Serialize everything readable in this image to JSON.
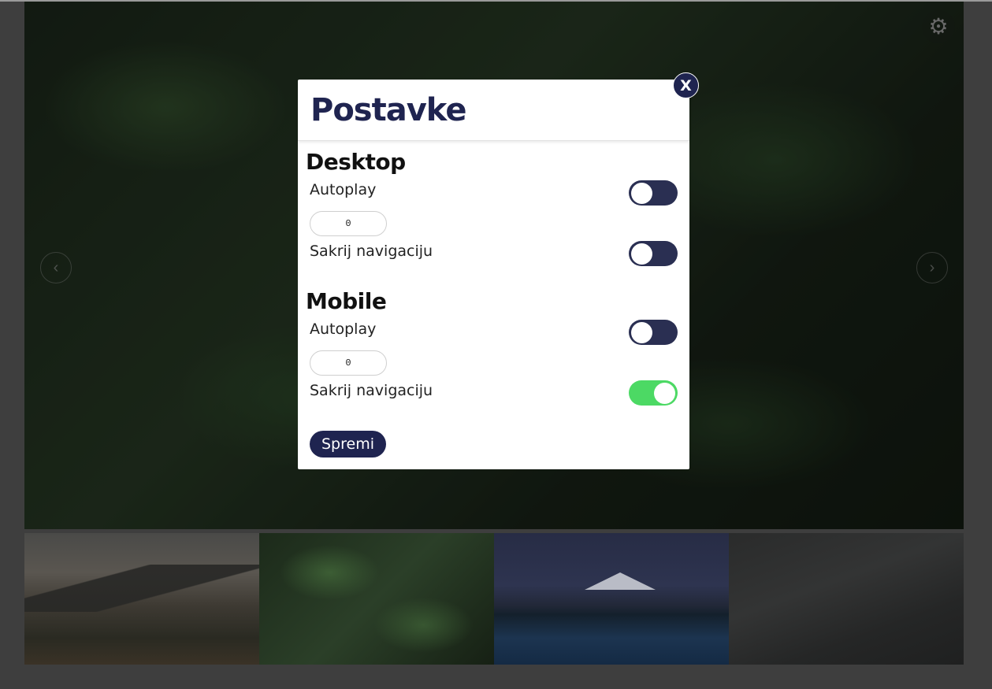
{
  "modal": {
    "title": "Postavke",
    "close_label": "X",
    "save_label": "Spremi",
    "desktop": {
      "heading": "Desktop",
      "autoplay_label": "Autoplay",
      "autoplay_on": false,
      "autoplay_interval": "0",
      "hide_nav_label": "Sakrij navigaciju",
      "hide_nav_on": false
    },
    "mobile": {
      "heading": "Mobile",
      "autoplay_label": "Autoplay",
      "autoplay_on": false,
      "autoplay_interval": "0",
      "hide_nav_label": "Sakrij navigaciju",
      "hide_nav_on": true
    }
  },
  "slider": {
    "prev_icon": "chevron-left-icon",
    "next_icon": "chevron-right-icon",
    "prev_glyph": "‹",
    "next_glyph": "›",
    "settings_icon": "gear-icon",
    "settings_glyph": "⚙",
    "thumbnails": [
      "mountain-valley",
      "green-leaves",
      "mountain-lake",
      "dark-texture"
    ]
  },
  "colors": {
    "accent": "#1f2450",
    "toggle_on": "#4cd964",
    "toggle_off": "#2a2f52"
  }
}
